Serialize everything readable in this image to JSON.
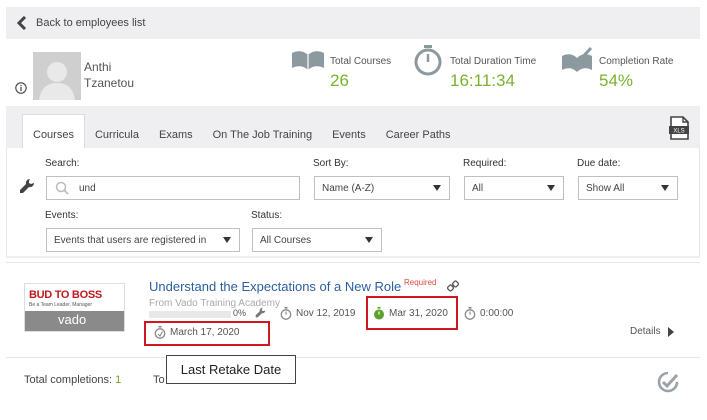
{
  "back": {
    "label": "Back to employees list",
    "icon": "chevron-left-icon"
  },
  "employee": {
    "first_name": "Anthi",
    "last_name": "Tzanetou"
  },
  "stats": [
    {
      "label": "Total Courses",
      "value": "26",
      "icon": "open-book-icon"
    },
    {
      "label": "Total Duration Time",
      "value": "16:11:34",
      "icon": "stopwatch-icon"
    },
    {
      "label": "Completion Rate",
      "value": "54%",
      "icon": "book-checkmark-icon"
    }
  ],
  "tabs": [
    "Courses",
    "Curricula",
    "Exams",
    "On The Job Training",
    "Events",
    "Career Paths"
  ],
  "active_tab": "Courses",
  "filters": {
    "search_label": "Search:",
    "search_value": "und",
    "sort_label": "Sort By:",
    "sort_value": "Name (A-Z)",
    "required_label": "Required:",
    "required_value": "All",
    "due_label": "Due date:",
    "due_value": "Show All",
    "events_label": "Events:",
    "events_value": "Events that users are registered in",
    "status_label": "Status:",
    "status_value": "All Courses"
  },
  "course": {
    "logo_title": "BUD TO BOSS",
    "logo_subtitle": "Be a Team Leader, Manager",
    "logo_brand": "vado",
    "title": "Understand the Expectations of a New Role",
    "required_tag": "Required",
    "from": "From Vado Training Academy",
    "progress_percent": "0%",
    "progress": 0,
    "assigned_date": "Nov 12, 2019",
    "due_date": "Mar 31, 2020",
    "duration": "0:00:00",
    "retake_date": "March 17, 2020",
    "details_label": "Details"
  },
  "bottom": {
    "total_completions_label": "Total completions:",
    "total_completions_value": "1",
    "second_label": "To"
  },
  "tooltip": "Last Retake Date",
  "colors": {
    "accent_green": "#7ab22e",
    "link_blue": "#2a5fa0",
    "highlight_red": "#d2161e",
    "required_red": "#e04a3a"
  }
}
